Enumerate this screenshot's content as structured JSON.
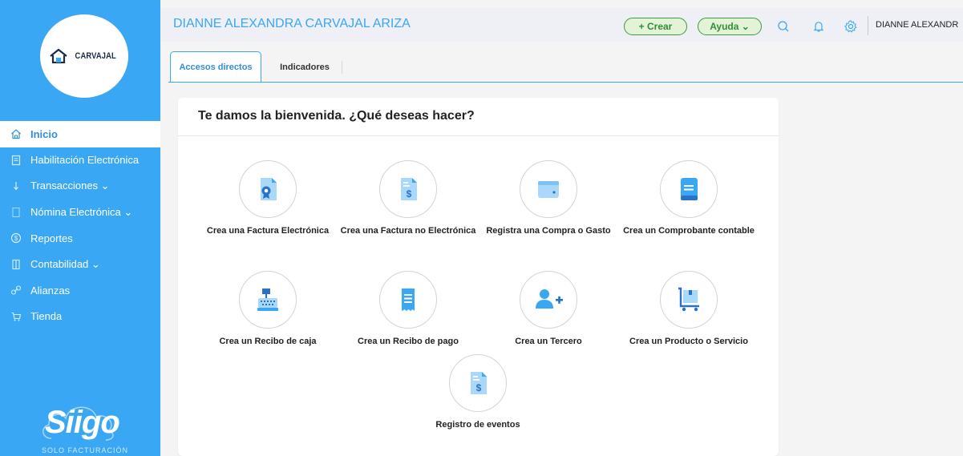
{
  "brand": {
    "logo_text": "CARVAJAL",
    "siigo_word": "Siigo",
    "siigo_sub": "SOLO FACTURACIÓN"
  },
  "sidebar": {
    "items": [
      {
        "label": "Inicio",
        "icon": "home-icon"
      },
      {
        "label": "Habilitación Electrónica",
        "icon": "document-icon"
      },
      {
        "label": "Transacciones ⌄",
        "icon": "transfer-icon"
      },
      {
        "label": "Nómina Electrónica ⌄",
        "icon": "payroll-icon"
      },
      {
        "label": "Reportes",
        "icon": "dollar-icon"
      },
      {
        "label": "Contabilidad ⌄",
        "icon": "ledger-icon"
      },
      {
        "label": "Alianzas",
        "icon": "link-icon"
      },
      {
        "label": "Tienda",
        "icon": "cart-icon"
      }
    ]
  },
  "header": {
    "title": "DIANNE ALEXANDRA CARVAJAL ARIZA",
    "crear_label": "+ Crear",
    "ayuda_label": "Ayuda ⌄",
    "user_short": "DIANNE ALEXANDR"
  },
  "tabs": [
    {
      "label": "Accesos directos",
      "active": true
    },
    {
      "label": "Indicadores",
      "active": false
    }
  ],
  "main": {
    "welcome": "Te damos la bienvenida. ¿Qué deseas hacer?",
    "actions": [
      {
        "label": "Crea una Factura Electrónica",
        "icon": "electronic-invoice-icon"
      },
      {
        "label": "Crea una Factura no Electrónica",
        "icon": "invoice-dollar-icon"
      },
      {
        "label": "Registra una Compra o Gasto",
        "icon": "wallet-icon"
      },
      {
        "label": "Crea un Comprobante contable",
        "icon": "ledger-book-icon"
      },
      {
        "label": "Crea un Recibo de caja",
        "icon": "cash-register-icon"
      },
      {
        "label": "Crea un Recibo de pago",
        "icon": "receipt-icon"
      },
      {
        "label": "Crea un Tercero",
        "icon": "add-person-icon"
      },
      {
        "label": "Crea un Producto o Servicio",
        "icon": "product-cart-icon"
      },
      {
        "label": "Registro de eventos",
        "icon": "event-document-icon"
      }
    ]
  },
  "colors": {
    "primary": "#3aa7f5",
    "accent_green": "#2e8f38",
    "icon_blue": "#3aa7f5"
  }
}
